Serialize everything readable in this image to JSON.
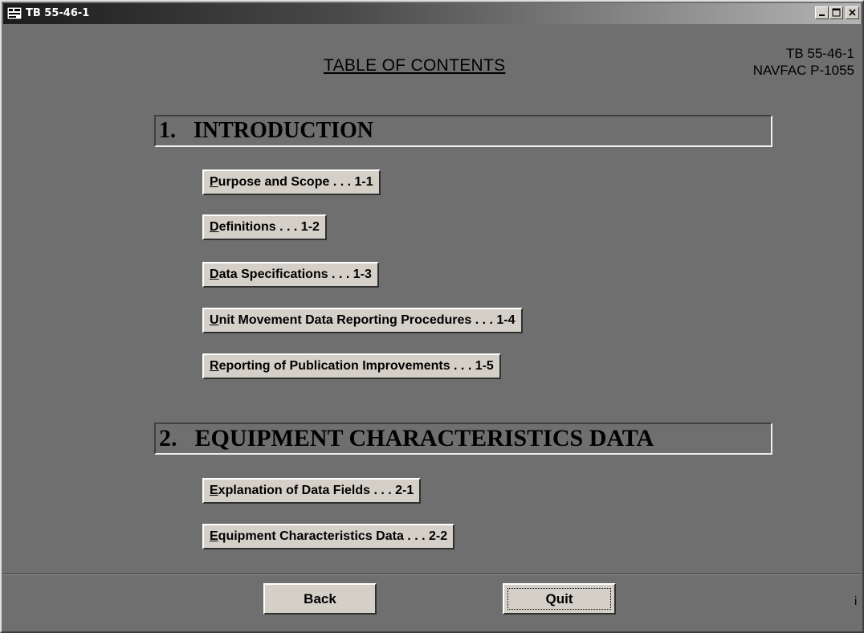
{
  "window": {
    "title": "TB 55-46-1",
    "controls": {
      "minimize": "minimize",
      "maximize": "maximize",
      "close": "close"
    }
  },
  "header": {
    "title": "TABLE OF CONTENTS",
    "doc_id": "TB 55-46-1",
    "navfac_id": "NAVFAC  P-1055"
  },
  "sections": [
    {
      "number": "1.",
      "title": "INTRODUCTION",
      "items": [
        {
          "hotkey": "P",
          "rest": "urpose and Scope . . . 1-1"
        },
        {
          "hotkey": "D",
          "rest": "efinitions . . . 1-2"
        },
        {
          "hotkey": "D",
          "rest": "ata Specifications . . . 1-3"
        },
        {
          "hotkey": "U",
          "rest": "nit Movement Data Reporting Procedures . . . 1-4"
        },
        {
          "hotkey": "R",
          "rest": "eporting of Publication Improvements . . . 1-5"
        }
      ]
    },
    {
      "number": "2.",
      "title": "EQUIPMENT CHARACTERISTICS DATA",
      "items": [
        {
          "hotkey": "E",
          "rest": "xplanation of Data Fields . . .  2-1"
        },
        {
          "hotkey": "E",
          "rest": "quipment Characteristics Data . . .  2-2"
        }
      ]
    }
  ],
  "footer": {
    "back_label": "Back",
    "quit_label": "Quit",
    "info": "i"
  },
  "colors": {
    "background": "#6f6f6f",
    "button_face": "#d4d0c8"
  }
}
